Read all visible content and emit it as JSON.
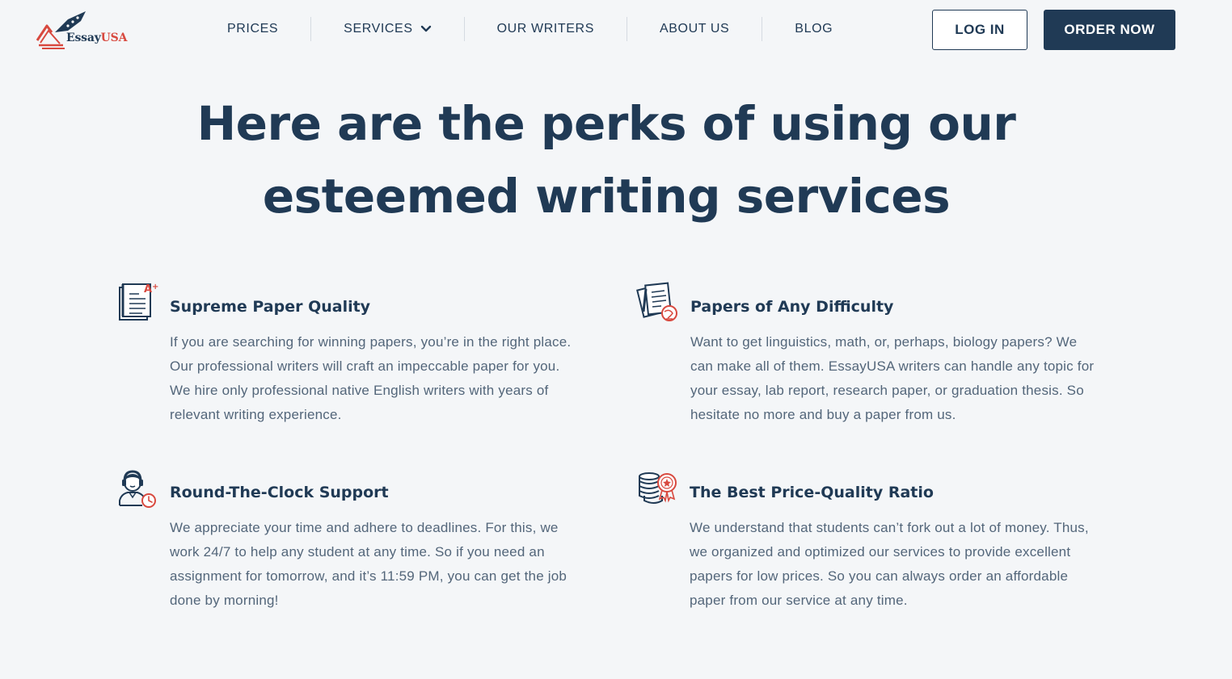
{
  "header": {
    "logo": {
      "brand_primary": "Essay",
      "brand_accent": "USA"
    },
    "nav": [
      {
        "label": "PRICES"
      },
      {
        "label": "SERVICES",
        "has_dropdown": true
      },
      {
        "label": "OUR WRITERS"
      },
      {
        "label": "ABOUT US"
      },
      {
        "label": "BLOG"
      }
    ],
    "login_label": "LOG IN",
    "order_label": "ORDER NOW"
  },
  "hero": {
    "headline_line1": "Here are the perks of using our",
    "headline_line2": "esteemed writing services"
  },
  "features": [
    {
      "icon": "paper-grade-icon",
      "title": "Supreme Paper Quality",
      "text": "If you are searching for winning papers, you’re in the right place. Our professional writers will craft an impeccable paper for you. We hire only professional native English writers with years of relevant writing experience."
    },
    {
      "icon": "papers-globe-icon",
      "title": "Papers of Any Difficulty",
      "text": "Want to get linguistics, math, or, perhaps, biology papers? We can make all of them. EssayUSA writers can handle any topic for your essay, lab report, research paper, or graduation thesis. So hesitate no more and buy a paper from us."
    },
    {
      "icon": "support-agent-icon",
      "title": "Round-The-Clock Support",
      "text": "We appreciate your time and adhere to deadlines. For this, we work 24/7 to help any student at any time. So if you need an assignment for tomorrow, and it’s 11:59 PM, you can get the job done by morning!"
    },
    {
      "icon": "coins-badge-icon",
      "title": "The Best Price-Quality Ratio",
      "text": "We understand that students can’t fork out a lot of money. Thus, we organized and optimized our services to provide excellent papers for low prices. So you can always order an affordable paper from our service at any time."
    }
  ],
  "colors": {
    "background": "#f4f6f8",
    "primary": "#203a55",
    "accent": "#d8493f",
    "body_text": "#53667a"
  }
}
